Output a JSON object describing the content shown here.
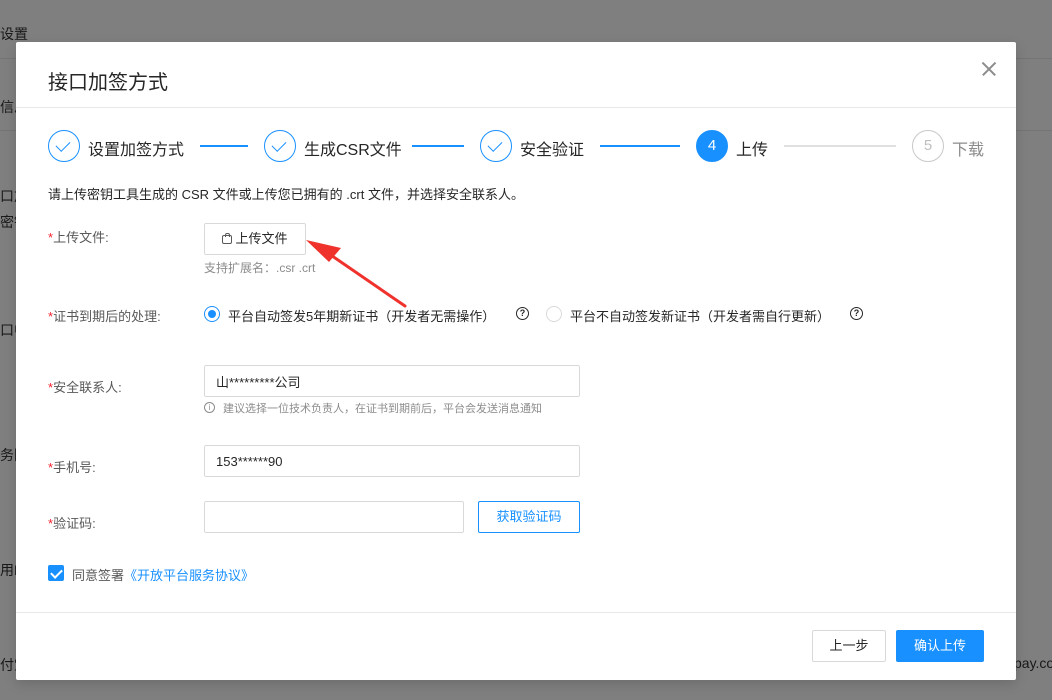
{
  "background": {
    "items": [
      "设置",
      "信息",
      "口加",
      "密钥",
      "口中",
      "务图",
      "用D",
      "付宝",
      "pay.com"
    ]
  },
  "modal": {
    "title": "接口加签方式",
    "close_label": "×"
  },
  "steps": [
    {
      "label": "设置加签方式",
      "status": "done"
    },
    {
      "label": "生成CSR文件",
      "status": "done"
    },
    {
      "label": "安全验证",
      "status": "done"
    },
    {
      "label": "上传",
      "number": "4",
      "status": "active"
    },
    {
      "label": "下载",
      "number": "5",
      "status": "wait"
    }
  ],
  "intro": "请上传密钥工具生成的 CSR 文件或上传您已拥有的 .crt 文件，并选择安全联系人。",
  "form": {
    "required_mark": "*",
    "upload": {
      "label": "上传文件:",
      "button": "上传文件",
      "hint": "支持扩展名：.csr .crt"
    },
    "expire": {
      "label": "证书到期后的处理:",
      "option1": "平台自动签发5年期新证书（开发者无需操作）",
      "option2": "平台不自动签发新证书（开发者需自行更新）",
      "help_icon": "?",
      "selected": "option1"
    },
    "contact": {
      "label": "安全联系人:",
      "value": "山*********公司",
      "hint": "建议选择一位技术负责人，在证书到期前后，平台会发送消息通知",
      "info_icon": "i"
    },
    "phone": {
      "label": "手机号:",
      "value": "153******90"
    },
    "code": {
      "label": "验证码:",
      "value": "",
      "button": "获取验证码"
    },
    "agree": {
      "prefix": "同意签署",
      "link": "《开放平台服务协议》",
      "checked": true
    }
  },
  "footer": {
    "prev": "上一步",
    "confirm": "确认上传"
  },
  "colors": {
    "primary": "#1890ff",
    "required": "#f5222d",
    "arrow": "#f0322d"
  }
}
